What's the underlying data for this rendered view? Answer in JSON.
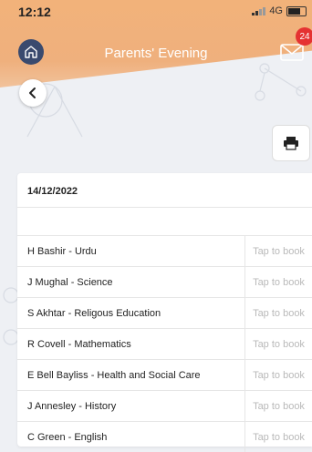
{
  "status": {
    "time": "12:12",
    "network": "4G"
  },
  "header": {
    "title": "Parents' Evening",
    "badge_count": "24"
  },
  "icons": {
    "home": "home-icon",
    "mail": "mail-icon",
    "back": "chevron-left-icon",
    "print": "printer-icon"
  },
  "colors": {
    "header": "#f0b07a",
    "badge": "#e53232",
    "home_button": "#3a4a6e"
  },
  "booking": {
    "date": "14/12/2022",
    "rows": [
      {
        "name": "H Bashir - Urdu",
        "action": "Tap to book"
      },
      {
        "name": "J Mughal - Science",
        "action": "Tap to book"
      },
      {
        "name": "S Akhtar - Religous Education",
        "action": "Tap to book"
      },
      {
        "name": "R Covell - Mathematics",
        "action": "Tap to book"
      },
      {
        "name": "E Bell Bayliss - Health and Social Care",
        "action": "Tap to book"
      },
      {
        "name": "J Annesley - History",
        "action": "Tap to book"
      },
      {
        "name": "C Green - English",
        "action": "Tap to book"
      }
    ]
  }
}
